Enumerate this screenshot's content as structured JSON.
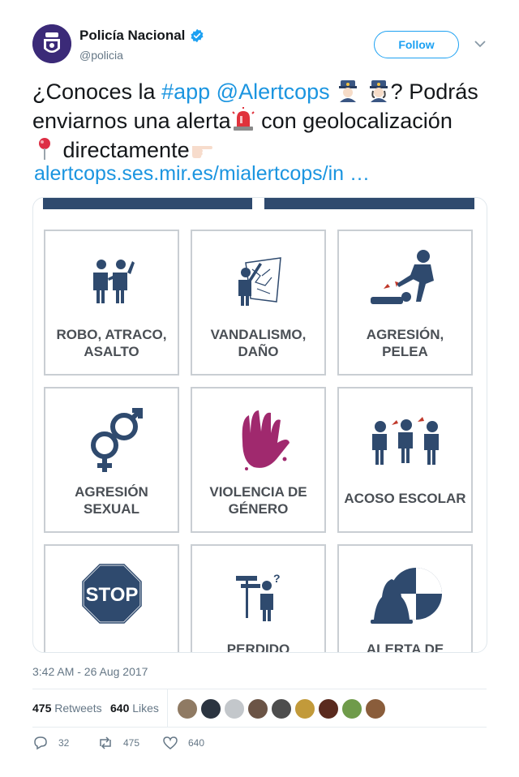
{
  "author": {
    "display_name": "Policía Nacional",
    "handle": "@policia",
    "verified": true,
    "avatar_icon": "police-badge-icon"
  },
  "follow_label": "Follow",
  "tweet": {
    "line1_a": "¿Conoces la ",
    "hashtag": "#app",
    "mention": "@Alertcops",
    "line1_b": "? Podrás",
    "line2_a": "enviarnos una alerta",
    "line2_b": " con geolocalización",
    "line3_a": " directamente",
    "url": "alertcops.ses.mir.es/mialertcops/in …",
    "emojis": [
      "police-officer-man-icon",
      "police-officer-woman-icon",
      "rotating-light-icon",
      "round-pushpin-icon",
      "pointing-right-icon"
    ]
  },
  "media": {
    "tiles": [
      {
        "label1": "ROBO, ATRACO,",
        "label2": "ASALTO",
        "icon": "robbery-icon"
      },
      {
        "label1": "VANDALISMO,",
        "label2": "DAÑO",
        "icon": "vandalism-icon"
      },
      {
        "label1": "AGRESIÓN,",
        "label2": "PELEA",
        "icon": "fight-icon"
      },
      {
        "label1": "AGRESIÓN",
        "label2": "SEXUAL",
        "icon": "gender-symbols-icon"
      },
      {
        "label1": "VIOLENCIA DE",
        "label2": "GÉNERO",
        "icon": "hand-print-icon"
      },
      {
        "label1": "ACOSO ESCOLAR",
        "label2": "",
        "icon": "bullying-icon"
      },
      {
        "label1": "",
        "label2": "",
        "icon": "stop-sign-icon",
        "sign_text": "STOP"
      },
      {
        "label1": "PERDIDO",
        "label2": "",
        "icon": "lost-person-icon"
      },
      {
        "label1": "ALERTA DE",
        "label2": "",
        "icon": "alarm-bell-icon"
      }
    ],
    "colors": {
      "navy": "#2f4a6e",
      "tile_border": "#c9ced3",
      "text": "#4a4f55",
      "magenta": "#a0296e"
    }
  },
  "timestamp": "3:42 AM - 26 Aug 2017",
  "stats": {
    "retweets_count": "475",
    "retweets_label": "Retweets",
    "likes_count": "640",
    "likes_label": "Likes"
  },
  "actions": {
    "reply_count": "32",
    "retweet_count": "475",
    "like_count": "640"
  },
  "colors": {
    "link": "#1b95e0",
    "accent": "#1da1f2",
    "muted": "#657786"
  }
}
